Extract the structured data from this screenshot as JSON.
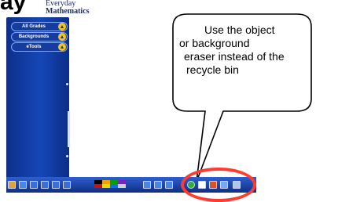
{
  "slide": {
    "title_fragment": "ay"
  },
  "brand": {
    "logo_line1": "Everyday",
    "logo_line2": "Mathematics"
  },
  "sidebar": {
    "items": [
      {
        "label": "All Grades",
        "icon": "chevron-up-icon"
      },
      {
        "label": "Backgrounds",
        "icon": "chevron-up-icon"
      },
      {
        "label": "eTools",
        "icon": "chevron-up-icon"
      }
    ]
  },
  "callout": {
    "lines": [
      "Use the object",
      "or background",
      "eraser instead of the",
      "recycle bin"
    ]
  },
  "toolbar": {
    "tools": [
      "home-icon",
      "text-icon",
      "pen-icon",
      "line-icon",
      "marker-icon",
      "eraser-icon"
    ],
    "colors": [
      "#000000",
      "#c81010",
      "#f0a000",
      "#e8d800",
      "#00a000",
      "#1070e0",
      "#8020c0",
      "#d0d0d0"
    ],
    "actions": [
      "calculator-icon",
      "settings-icon",
      "undo-icon",
      "help-icon",
      "object-eraser-icon",
      "background-eraser-icon",
      "picture-icon",
      "recycle-bin-icon"
    ]
  },
  "colors": {
    "highlight": "#ff3b2f",
    "panel": "#1547b8",
    "accent": "#f4c420"
  }
}
